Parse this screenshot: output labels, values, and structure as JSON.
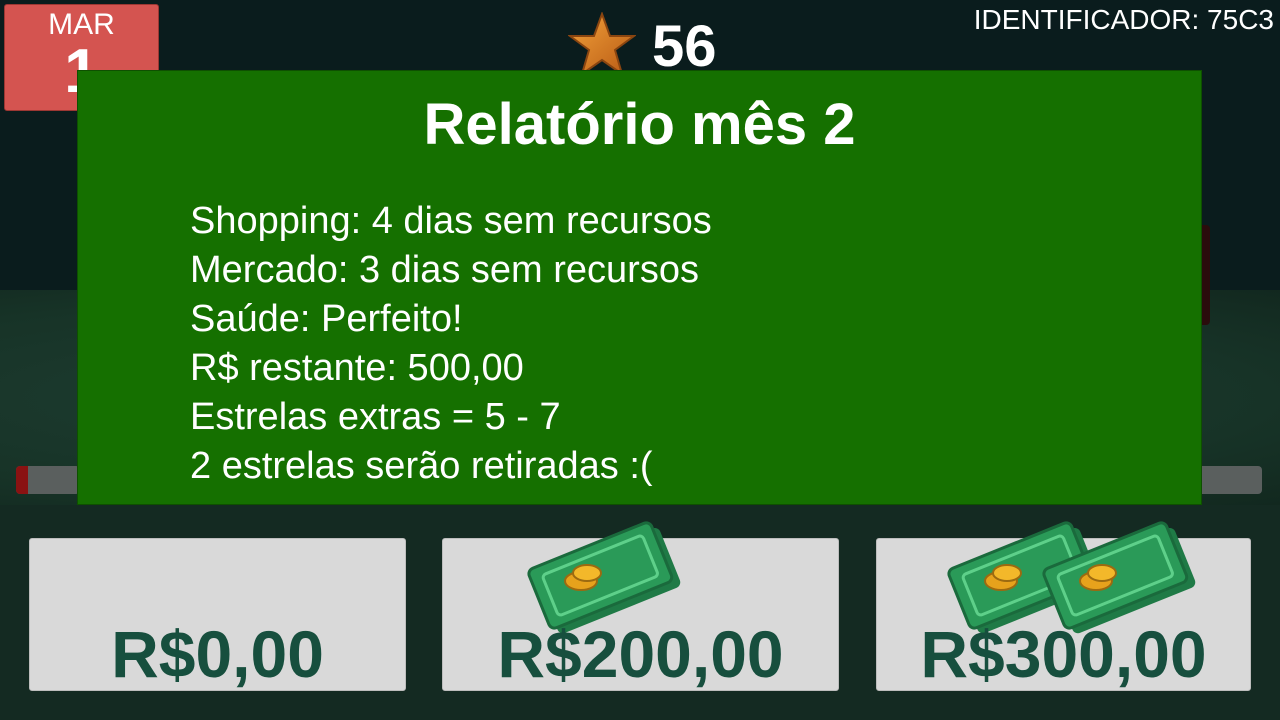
{
  "calendar": {
    "month": "MAR",
    "day": "1"
  },
  "score": {
    "icon": "star-icon",
    "value": "56"
  },
  "identifier": "IDENTIFICADOR: 75C3",
  "report": {
    "title": "Relatório mês 2",
    "lines": [
      "Shopping: 4 dias sem recursos",
      "Mercado: 3 dias sem recursos",
      "Saúde: Perfeito!",
      "R$ restante: 500,00",
      "Estrelas extras = 5 - 7",
      "2 estrelas serão retiradas :("
    ]
  },
  "options": [
    {
      "price": "R$0,00",
      "bills": 0
    },
    {
      "price": "R$200,00",
      "bills": 1,
      "icon": "cash-icon"
    },
    {
      "price": "R$300,00",
      "bills": 2,
      "icon": "cash-icon"
    }
  ],
  "colors": {
    "panel": "#157000",
    "calendar": "#d45450",
    "price_text": "#174f3e",
    "card": "#d9d9d9"
  }
}
